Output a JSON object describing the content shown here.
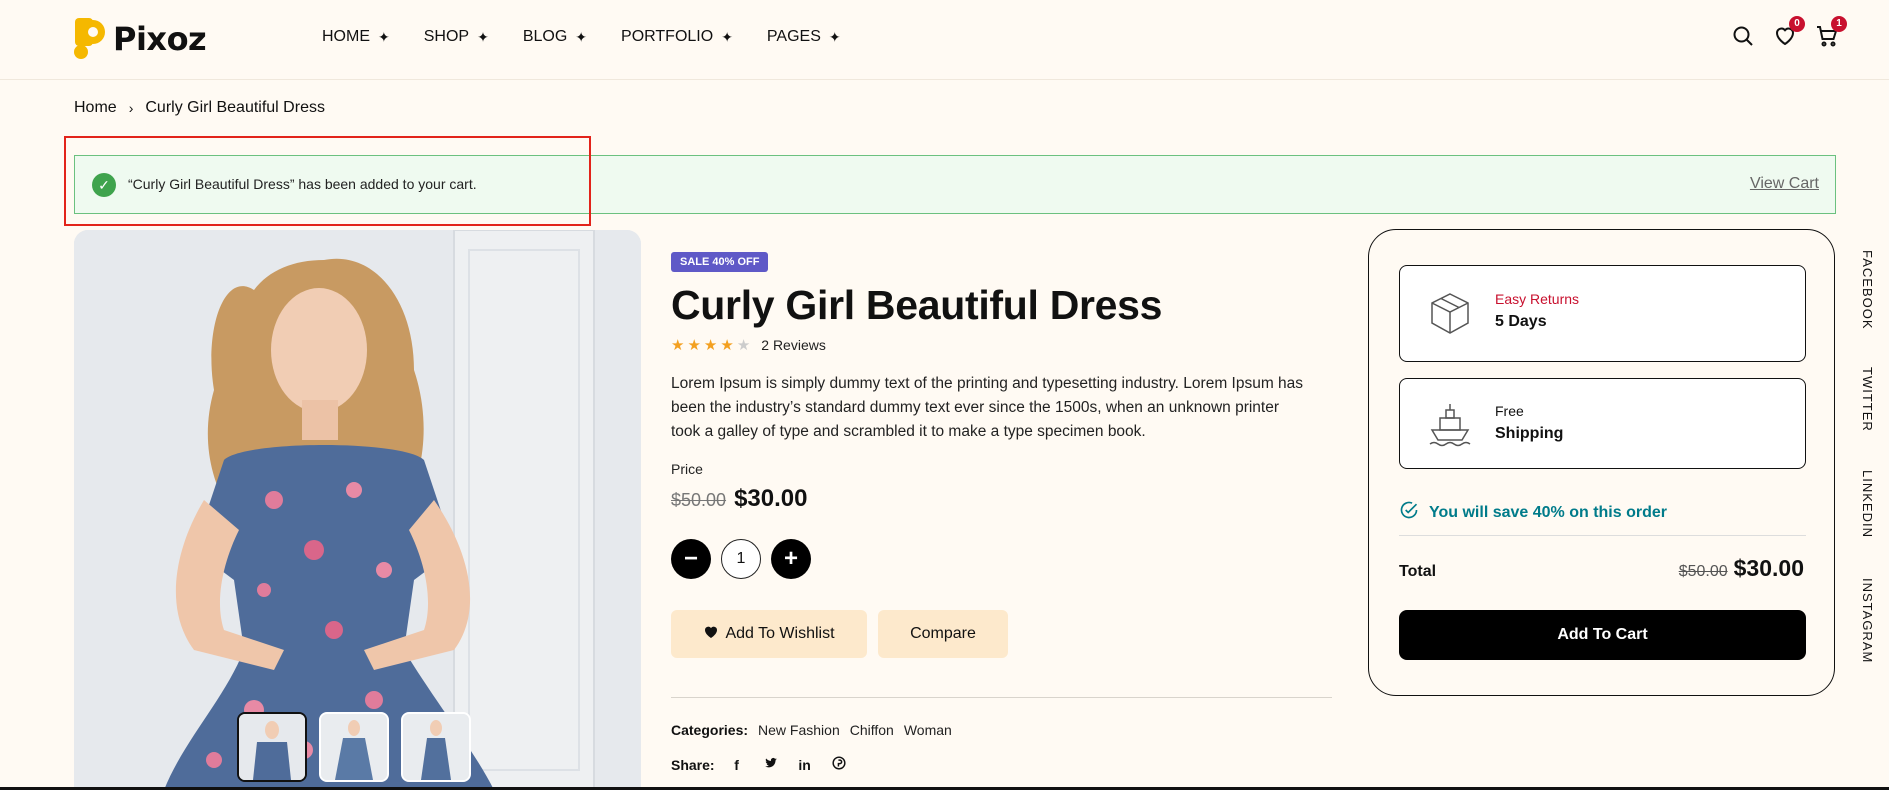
{
  "brand": {
    "name": "Pixoz",
    "accent": "#f5b800"
  },
  "nav": [
    {
      "label": "HOME"
    },
    {
      "label": "SHOP"
    },
    {
      "label": "BLOG"
    },
    {
      "label": "PORTFOLIO"
    },
    {
      "label": "PAGES"
    }
  ],
  "header": {
    "wishlist_count": "0",
    "cart_count": "1"
  },
  "breadcrumb": {
    "home": "Home",
    "current": "Curly Girl Beautiful Dress"
  },
  "notice": {
    "message": "“Curly Girl Beautiful Dress” has been added to your cart.",
    "action": "View Cart"
  },
  "product": {
    "badge": "SALE 40% OFF",
    "title": "Curly Girl Beautiful Dress",
    "rating": 4,
    "reviews": "2 Reviews",
    "description": "Lorem Ipsum is simply dummy text of the printing and typesetting industry. Lorem Ipsum has been the industry’s standard dummy text ever since the 1500s, when an unknown printer took a galley of type and scrambled it to make a type specimen book.",
    "price_label": "Price",
    "old_price": "$50.00",
    "new_price": "$30.00",
    "quantity": "1",
    "wishlist_label": "Add To Wishlist",
    "compare_label": "Compare",
    "categories_label": "Categories:",
    "categories": [
      "New Fashion",
      "Chiffon",
      "Woman"
    ],
    "share_label": "Share:"
  },
  "card": {
    "returns_top": "Easy Returns",
    "returns_bottom": "5 Days",
    "shipping_top": "Free",
    "shipping_bottom": "Shipping",
    "save_text": "You will save 40% on this order",
    "total_label": "Total",
    "old_total": "$50.00",
    "new_total": "$30.00",
    "cta": "Add To Cart"
  },
  "social_vertical": [
    "FACEBOOK",
    "TWITTER",
    "LINKEDIN",
    "INSTAGRAM"
  ]
}
